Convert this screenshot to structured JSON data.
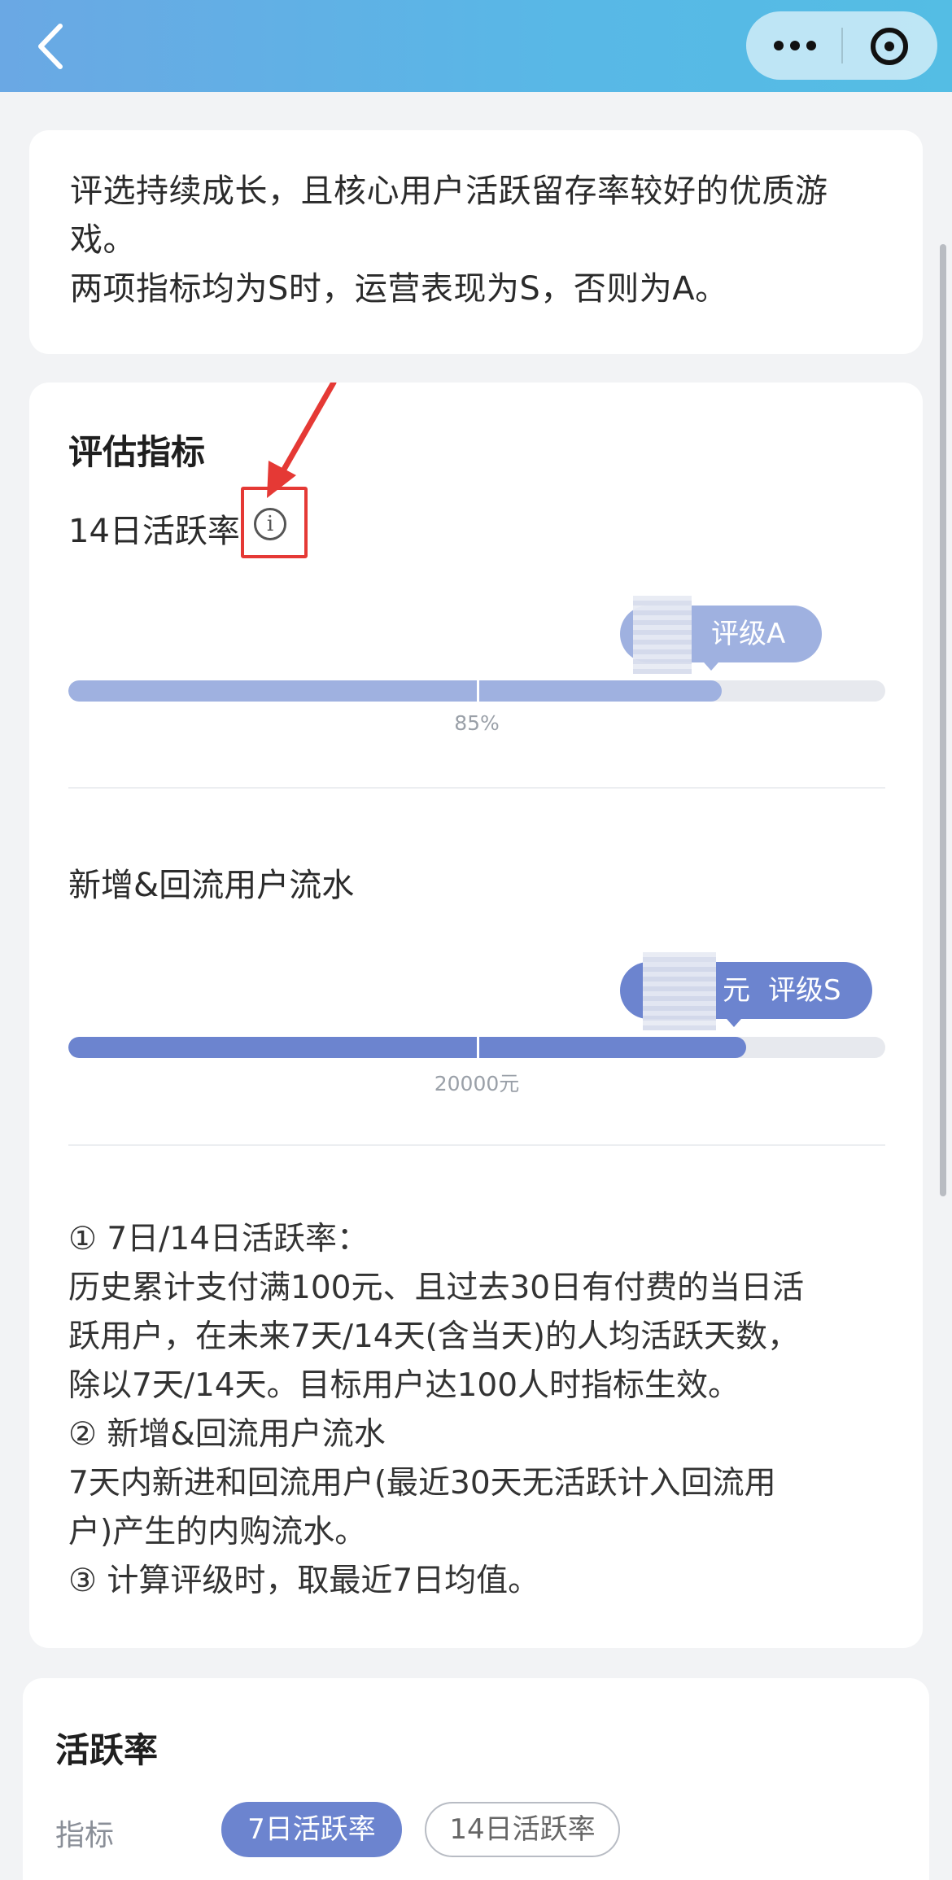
{
  "colors": {
    "header_start": "#6aa8e4",
    "header_end": "#54bde4",
    "bar_a": "#9fb1e0",
    "bar_s": "#6c84cf",
    "track": "#e7e9ee",
    "annotation": "#e53935"
  },
  "header": {
    "back_icon": "chevron-left-icon",
    "more_icon": "more-dots-icon",
    "close_icon": "target-circle-icon"
  },
  "intro": {
    "line1": "评选持续成长，且核心用户活跃留存率较好的优质游",
    "line2": "戏。",
    "line3": "两项指标均为S时，运营表现为S，否则为A。"
  },
  "evaluation": {
    "title": "评估指标",
    "metrics": [
      {
        "label": "14日活跃率",
        "bubble_suffix": "评级A",
        "bubble_prefix": "",
        "progress": 0.8,
        "threshold_fraction": 0.5,
        "threshold_label": "85%",
        "grade": "A"
      },
      {
        "label": "新增&回流用户流水",
        "bubble_suffix": "评级S",
        "bubble_prefix": "元",
        "progress": 0.83,
        "threshold_fraction": 0.5,
        "threshold_label": "20000元",
        "grade": "S"
      }
    ]
  },
  "notes": {
    "l1": "① 7日/14日活跃率：",
    "l2": "历史累计支付满100元、且过去30日有付费的当日活",
    "l3": "跃用户，在未来7天/14天(含当天)的人均活跃天数，",
    "l4": "除以7天/14天。目标用户达100人时指标生效。",
    "l5": "② 新增&回流用户流水",
    "l6": "7天内新进和回流用户(最近30天无活跃计入回流用",
    "l7": "户)产生的内购流水。",
    "l8": "③ 计算评级时，取最近7日均值。"
  },
  "activity": {
    "title": "活跃率",
    "row_label": "指标",
    "options": [
      "7日活跃率",
      "14日活跃率"
    ],
    "selected": "7日活跃率"
  }
}
